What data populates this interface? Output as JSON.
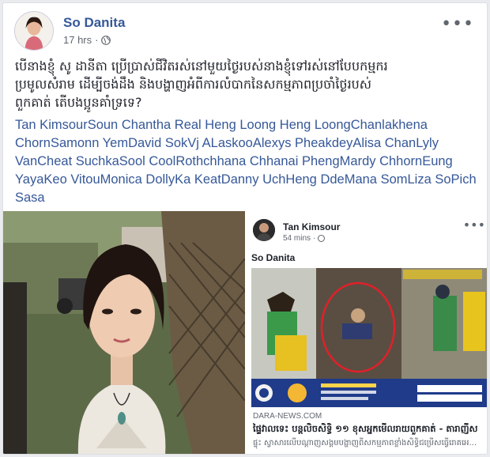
{
  "post": {
    "author": "So Danita",
    "time": "17 hrs",
    "dot": "·",
    "privacy_icon": "globe-icon",
    "more_label": "•••",
    "text_khmer": "បើនាងខ្ញុំ សូ ដានីតា ប្រើប្រាស់ជីវិតរស់នៅមួយថ្ងៃរបស់នាងខ្ញុំទៅរស់នៅបែបកម្មករ\nប្រមូលសំរាម ដើម្បីចង់ដឹង និងបង្ហាញអំពីការលំបាកនៃសកម្មភាពប្រចាំថ្ងៃរបស់\nពួកគាត់ តើបងប្អូនគាំទ្រទេ?",
    "tags": "Tan KimsourSoun Chantha Real Heng Loong Heng LoongChanlakhena ChornSamonn YemDavid SokVj ALaskooAlexys PheakdeyAlisa ChanLyly VanCheat SuchkaSool CoolRothchhana Chhanai PhengMardy ChhornEung YayaKeo VitouMonica DollyKa KeatDanny UchHeng DdeMana SomLiza SoPich Sasa"
  },
  "shared": {
    "author": "Tan Kimsour",
    "time": "54 mins",
    "dot": "·",
    "more_label": "•••",
    "mention": "So Danita",
    "site": "DARA-NEWS.COM",
    "title": "ផ្ទៃវាលទេះ បន្តលិចសិទ្ធិ ១១ ខុសអ្នកមើលរាយពួកគាត់ - តារាញីស",
    "description": "ផ្ទុះ ស្វាសារលើបណ្តាញសង្គមបង្ហាញពីសកម្មភាពខ្លាំងសិទ្ធិជម្រើសធ្វើរោគអេ..."
  },
  "colors": {
    "link": "#365899",
    "text": "#1d2129",
    "meta": "#616770"
  }
}
